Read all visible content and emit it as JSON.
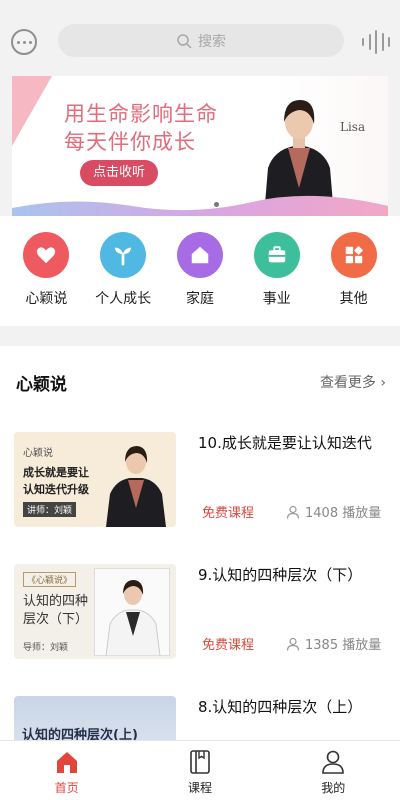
{
  "header": {
    "search_placeholder": "搜索"
  },
  "banner": {
    "line1": "用生命影响生命",
    "line2": "每天伴你成长",
    "button": "点击收听",
    "name": "Lisa"
  },
  "categories": [
    {
      "label": "心颖说",
      "icon": "heart-icon",
      "color": "#ef5a60"
    },
    {
      "label": "个人成长",
      "icon": "sprout-icon",
      "color": "#4fb9e3"
    },
    {
      "label": "家庭",
      "icon": "home-icon",
      "color": "#a86be6"
    },
    {
      "label": "事业",
      "icon": "briefcase-icon",
      "color": "#3cbf9a"
    },
    {
      "label": "其他",
      "icon": "grid-icon",
      "color": "#f26b47"
    }
  ],
  "section": {
    "title": "心颖说",
    "more": "查看更多"
  },
  "courses": [
    {
      "title": "10.成长就是要让认知迭代",
      "thumb_line1": "心颖说",
      "thumb_line2": "成长就是要让",
      "thumb_line3": "认知迭代升级",
      "thumb_author": "讲师：刘颖",
      "tag": "免费课程",
      "plays": "1408 播放量"
    },
    {
      "title": "9.认知的四种层次（下）",
      "thumb_line1": "《心颖说》",
      "thumb_line2": "认知的四种",
      "thumb_line3": "层次（下）",
      "thumb_author": "导师：刘颖",
      "tag": "免费课程",
      "plays": "1385 播放量"
    },
    {
      "title": "8.认知的四种层次（上）",
      "thumb_line1": "认知的四种层次(上)",
      "thumb_line2": "",
      "thumb_line3": "",
      "thumb_author": "",
      "tag": "",
      "plays": ""
    }
  ],
  "tabs": [
    {
      "label": "首页",
      "icon": "home-icon",
      "active": true
    },
    {
      "label": "课程",
      "icon": "book-icon",
      "active": false
    },
    {
      "label": "我的",
      "icon": "user-icon",
      "active": false
    }
  ],
  "colors": {
    "accent": "#e2453a",
    "banner_pink": "#e06c7c",
    "button_pink": "#d94b63"
  }
}
